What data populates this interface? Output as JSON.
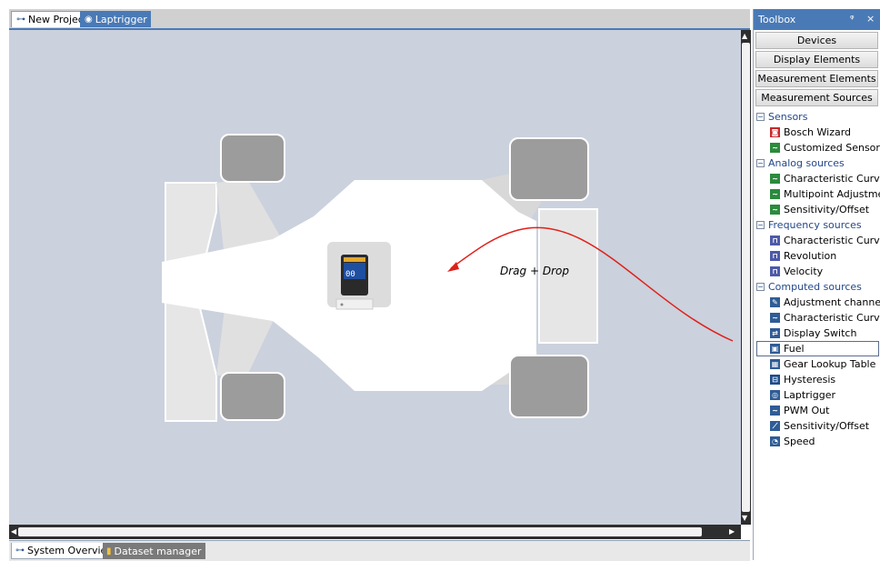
{
  "top_tabs": [
    {
      "label": "New Project",
      "icon": "network-icon"
    },
    {
      "label": "Laptrigger",
      "icon": "laptrigger-icon"
    }
  ],
  "canvas": {
    "annotation": "Drag + Drop",
    "device_icon": "display-unit-icon"
  },
  "bottom_tabs": [
    {
      "label": "System Overview",
      "icon": "network-icon"
    },
    {
      "label": "Dataset manager",
      "icon": "folder-icon"
    }
  ],
  "toolbox": {
    "title": "Toolbox",
    "pin_glyph": "ᵠ",
    "close_glyph": "×",
    "buttons": [
      "Devices",
      "Display Elements",
      "Measurement Elements",
      "Measurement Sources"
    ],
    "categories": [
      {
        "label": "Sensors",
        "items": [
          {
            "label": "Bosch Wizard",
            "icon": "bosch-wizard-icon",
            "color": "red"
          },
          {
            "label": "Customized Sensor",
            "icon": "sensor-curve-icon",
            "color": "green"
          }
        ]
      },
      {
        "label": "Analog sources",
        "items": [
          {
            "label": "Characteristic Curve",
            "icon": "curve-icon",
            "color": "green"
          },
          {
            "label": "Multipoint Adjustment",
            "icon": "multipoint-icon",
            "color": "green"
          },
          {
            "label": "Sensitivity/Offset",
            "icon": "sensitivity-icon",
            "color": "green"
          }
        ]
      },
      {
        "label": "Frequency sources",
        "items": [
          {
            "label": "Characteristic Curve",
            "icon": "frequency-curve-icon",
            "color": "purple"
          },
          {
            "label": "Revolution",
            "icon": "revolution-icon",
            "color": "purple"
          },
          {
            "label": "Velocity",
            "icon": "velocity-icon",
            "color": "purple"
          }
        ]
      },
      {
        "label": "Computed sources",
        "items": [
          {
            "label": "Adjustment channel",
            "icon": "adjustment-icon",
            "color": "blue"
          },
          {
            "label": "Characteristic Curve",
            "icon": "computed-curve-icon",
            "color": "blue"
          },
          {
            "label": "Display Switch",
            "icon": "display-switch-icon",
            "color": "blue"
          },
          {
            "label": "Fuel",
            "icon": "fuel-icon",
            "color": "blue"
          },
          {
            "label": "Gear Lookup Table",
            "icon": "table-icon",
            "color": "blue"
          },
          {
            "label": "Hysteresis",
            "icon": "hysteresis-icon",
            "color": "blue"
          },
          {
            "label": "Laptrigger",
            "icon": "laptrigger-icon",
            "color": "blue"
          },
          {
            "label": "PWM Out",
            "icon": "pwm-icon",
            "color": "blue"
          },
          {
            "label": "Sensitivity/Offset",
            "icon": "computed-sensitivity-icon",
            "color": "blue"
          },
          {
            "label": "Speed",
            "icon": "speed-icon",
            "color": "blue"
          }
        ]
      }
    ],
    "selected_item": "Fuel"
  },
  "colors": {
    "accent": "#4a7ab6",
    "canvas_bg": "#cbd1dd",
    "arrow": "#e0201a",
    "category_text": "#23488a"
  }
}
